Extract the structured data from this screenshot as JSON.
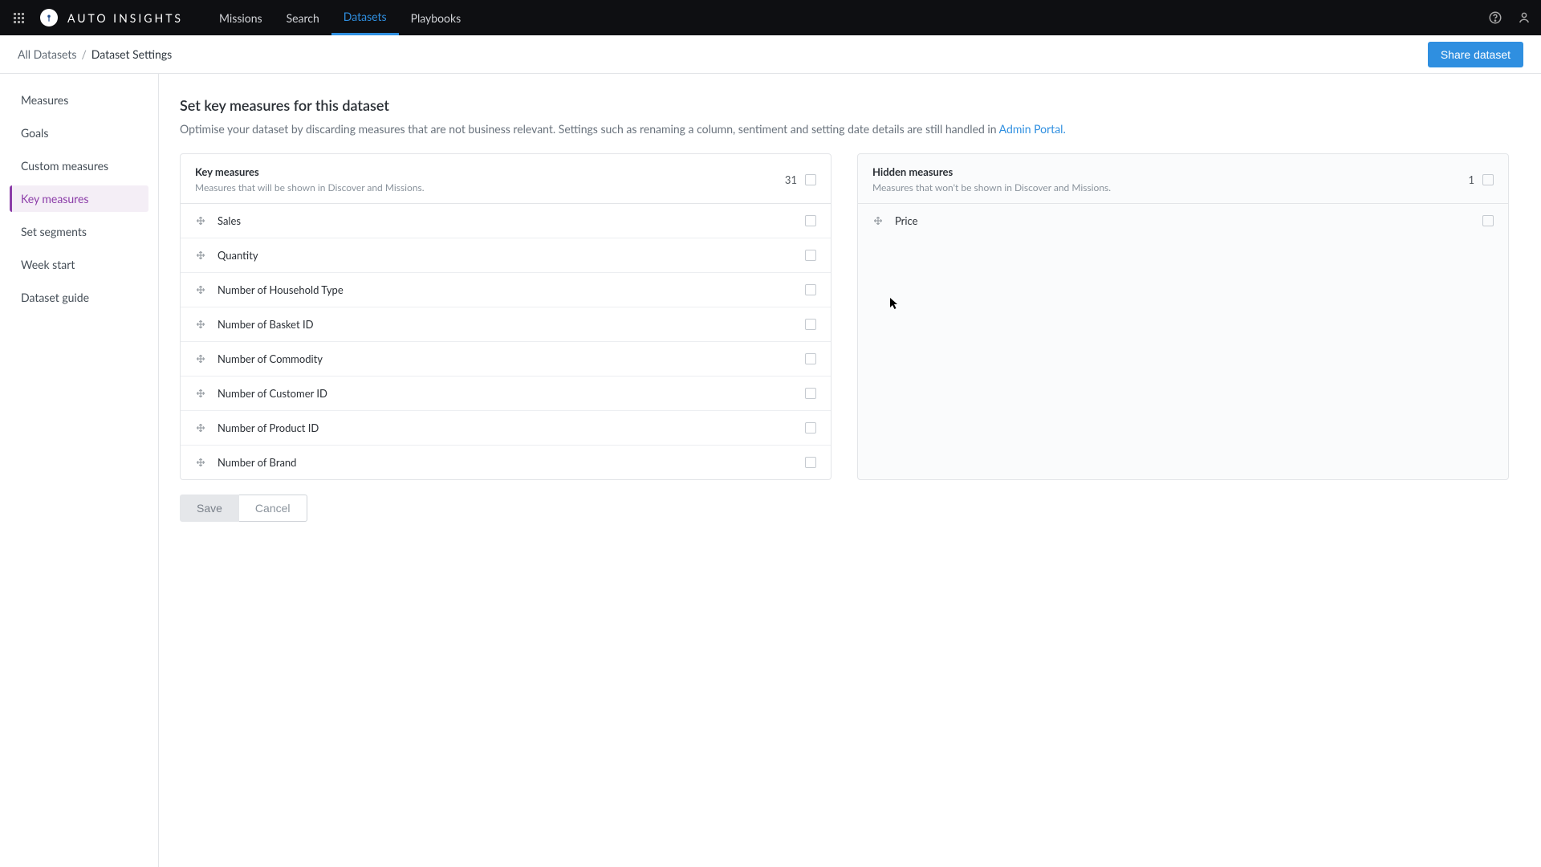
{
  "brand": {
    "name": "AUTO INSIGHTS"
  },
  "nav": {
    "items": [
      {
        "label": "Missions",
        "active": false
      },
      {
        "label": "Search",
        "active": false
      },
      {
        "label": "Datasets",
        "active": true
      },
      {
        "label": "Playbooks",
        "active": false
      }
    ]
  },
  "breadcrumb": {
    "parent": "All Datasets",
    "current": "Dataset Settings"
  },
  "share_label": "Share dataset",
  "sidebar": {
    "items": [
      {
        "label": "Measures",
        "active": false
      },
      {
        "label": "Goals",
        "active": false
      },
      {
        "label": "Custom measures",
        "active": false
      },
      {
        "label": "Key measures",
        "active": true
      },
      {
        "label": "Set segments",
        "active": false
      },
      {
        "label": "Week start",
        "active": false
      },
      {
        "label": "Dataset guide",
        "active": false
      }
    ]
  },
  "page": {
    "title": "Set key measures for this dataset",
    "desc_prefix": "Optimise your dataset by discarding measures that are not business relevant. Settings such as renaming a column, sentiment and setting date details are still handled in ",
    "desc_link": "Admin Portal.",
    "key_panel_title": "Key measures",
    "key_panel_subtitle": "Measures that will be shown in Discover and Missions.",
    "key_count": "31",
    "hidden_panel_title": "Hidden measures",
    "hidden_panel_subtitle": "Measures that won't be shown in Discover and Missions.",
    "hidden_count": "1"
  },
  "key_measures": [
    {
      "label": "Sales"
    },
    {
      "label": "Quantity"
    },
    {
      "label": "Number of Household Type"
    },
    {
      "label": "Number of Basket ID"
    },
    {
      "label": "Number of Commodity"
    },
    {
      "label": "Number of Customer ID"
    },
    {
      "label": "Number of Product ID"
    },
    {
      "label": "Number of Brand"
    }
  ],
  "hidden_measures": [
    {
      "label": "Price"
    }
  ],
  "actions": {
    "save": "Save",
    "cancel": "Cancel"
  }
}
